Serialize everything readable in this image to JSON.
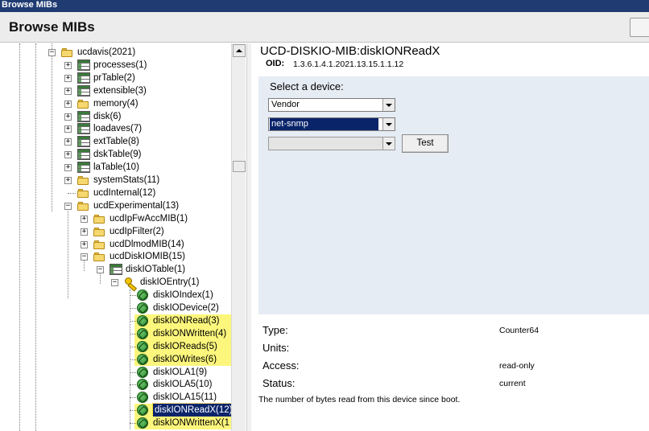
{
  "window_title": "Browse MIBs",
  "header": {
    "title": "Browse MIBs"
  },
  "tree": {
    "nodes": [
      {
        "label": "ucdavis(2021)",
        "icon": "folder-icon",
        "expander": "minus"
      },
      {
        "label": "processes(1)",
        "icon": "table-icon",
        "expander": "plus"
      },
      {
        "label": "prTable(2)",
        "icon": "table-icon",
        "expander": "plus"
      },
      {
        "label": "extensible(3)",
        "icon": "table-icon",
        "expander": "plus"
      },
      {
        "label": "memory(4)",
        "icon": "folder-icon",
        "expander": "plus"
      },
      {
        "label": "disk(6)",
        "icon": "table-icon",
        "expander": "plus"
      },
      {
        "label": "loadaves(7)",
        "icon": "table-icon",
        "expander": "plus"
      },
      {
        "label": "extTable(8)",
        "icon": "table-icon",
        "expander": "plus"
      },
      {
        "label": "dskTable(9)",
        "icon": "table-icon",
        "expander": "plus"
      },
      {
        "label": "laTable(10)",
        "icon": "table-icon",
        "expander": "plus"
      },
      {
        "label": "systemStats(11)",
        "icon": "folder-icon",
        "expander": "plus"
      },
      {
        "label": "ucdInternal(12)",
        "icon": "folder-icon",
        "expander": "none"
      },
      {
        "label": "ucdExperimental(13)",
        "icon": "folder-icon",
        "expander": "minus"
      },
      {
        "label": "ucdIpFwAccMIB(1)",
        "icon": "folder-icon",
        "expander": "plus"
      },
      {
        "label": "ucdIpFilter(2)",
        "icon": "folder-icon",
        "expander": "plus"
      },
      {
        "label": "ucdDlmodMIB(14)",
        "icon": "folder-icon",
        "expander": "plus"
      },
      {
        "label": "ucdDiskIOMIB(15)",
        "icon": "folder-icon",
        "expander": "minus"
      },
      {
        "label": "diskIOTable(1)",
        "icon": "table-icon",
        "expander": "minus"
      },
      {
        "label": "diskIOEntry(1)",
        "icon": "key-icon",
        "expander": "minus"
      },
      {
        "label": "diskIOIndex(1)",
        "icon": "leaf-icon",
        "expander": "none"
      },
      {
        "label": "diskIODevice(2)",
        "icon": "leaf-icon",
        "expander": "none"
      },
      {
        "label": "diskIONRead(3)",
        "icon": "leaf-icon",
        "expander": "none",
        "highlight": true
      },
      {
        "label": "diskIONWritten(4)",
        "icon": "leaf-icon",
        "expander": "none",
        "highlight": true
      },
      {
        "label": "diskIOReads(5)",
        "icon": "leaf-icon",
        "expander": "none",
        "highlight": true
      },
      {
        "label": "diskIOWrites(6)",
        "icon": "leaf-icon",
        "expander": "none",
        "highlight": true
      },
      {
        "label": "diskIOLA1(9)",
        "icon": "leaf-icon",
        "expander": "none"
      },
      {
        "label": "diskIOLA5(10)",
        "icon": "leaf-icon",
        "expander": "none"
      },
      {
        "label": "diskIOLA15(11)",
        "icon": "leaf-icon",
        "expander": "none"
      },
      {
        "label": "diskIONReadX(12)",
        "icon": "leaf-icon",
        "expander": "none",
        "highlight": true,
        "selected": true
      },
      {
        "label": "diskIONWrittenX(1",
        "icon": "leaf-icon",
        "expander": "none",
        "highlight": true
      }
    ]
  },
  "detail": {
    "mib_title": "UCD-DISKIO-MIB:diskIONReadX",
    "oid_label": "OID:",
    "oid_value": "1.3.6.1.4.1.2021.13.15.1.1.12",
    "device_section": {
      "label": "Select a device:",
      "vendor_select": "Vendor",
      "agent_select": "net-snmp",
      "device_select": "",
      "test_button": "Test"
    },
    "properties": [
      {
        "label": "Type:",
        "value": "Counter64"
      },
      {
        "label": "Units:",
        "value": ""
      },
      {
        "label": "Access:",
        "value": "read-only"
      },
      {
        "label": "Status:",
        "value": "current"
      }
    ],
    "description": "The number of bytes read from this device since boot."
  },
  "colors": {
    "titlebar": "#1f3b72",
    "highlight": "#fcf67c",
    "selection": "#0a246a",
    "device_panel": "#e6ecf4"
  }
}
